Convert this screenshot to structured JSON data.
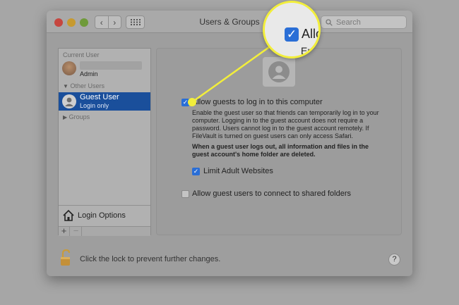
{
  "window": {
    "title": "Users & Groups",
    "search_placeholder": "Search"
  },
  "sidebar": {
    "current_user_header": "Current User",
    "current_user_role": "Admin",
    "other_users_header": "Other Users",
    "guest_name": "Guest User",
    "guest_status": "Login only",
    "groups_label": "Groups",
    "login_options_label": "Login Options",
    "add_label": "+",
    "remove_label": "−"
  },
  "main": {
    "allow_guests_label": "Allow guests to log in to this computer",
    "allow_guests_checked": true,
    "description": [
      "Enable the guest user so that friends can temporarily log in to your",
      "computer. Logging in to the guest account does not require a",
      "password. Users cannot log in to the guest account remotely. If",
      "FileVault is turned on guest users can only access Safari."
    ],
    "warning": [
      "When a guest user logs out, all information and files in the",
      "guest account's home folder are deleted."
    ],
    "limit_adult_label": "Limit Adult Websites",
    "limit_adult_checked": true,
    "shared_folders_label": "Allow guest users to connect to shared folders",
    "shared_folders_checked": false
  },
  "footer": {
    "lock_text": "Click the lock to prevent further changes.",
    "help_label": "?"
  },
  "callout": {
    "text_line1": "Allo",
    "text_line2": "Ena"
  },
  "colors": {
    "accent": "#2a6ed6",
    "selection": "#1a4f9b",
    "callout": "#f2ee3b"
  }
}
